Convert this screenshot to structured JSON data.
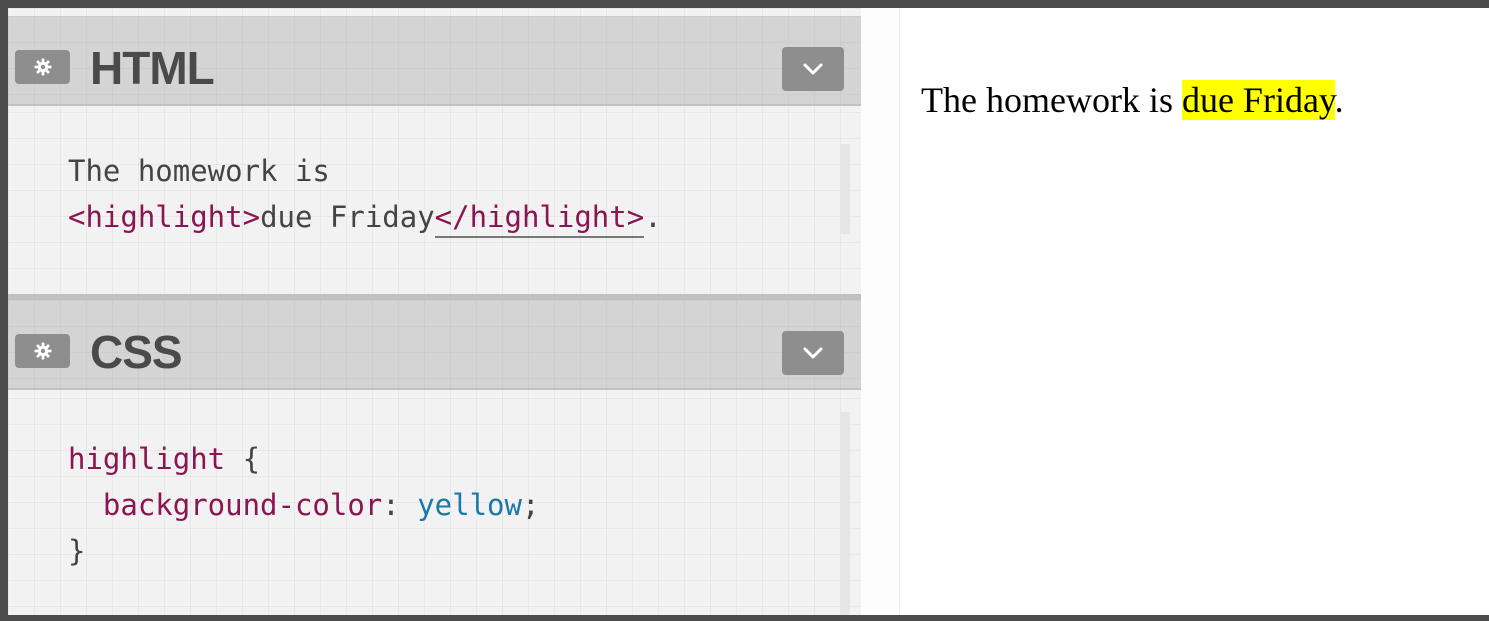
{
  "html_panel": {
    "title": "HTML",
    "gear_icon": "gear-icon",
    "collapse_icon": "chevron-down-icon",
    "code": {
      "line1": "The homework is",
      "line2_open_tag": "<highlight>",
      "line2_text": "due Friday",
      "line2_close_tag": "</highlight>",
      "line2_end": "."
    }
  },
  "css_panel": {
    "title": "CSS",
    "gear_icon": "gear-icon",
    "collapse_icon": "chevron-down-icon",
    "code": {
      "selector": "highlight",
      "open_brace": " {",
      "indent": "  ",
      "property": "background-color",
      "colon": ": ",
      "value": "yellow",
      "semicolon": ";",
      "close_brace": "}"
    }
  },
  "preview": {
    "text_before": "The homework is ",
    "highlighted": "due Friday",
    "text_after": ".",
    "highlight_color": "#ffff00"
  },
  "colors": {
    "tag": "#8b1452",
    "value": "#1a79a8",
    "header_bg": "#d4d4d4",
    "button_bg": "#8e8e8e"
  }
}
